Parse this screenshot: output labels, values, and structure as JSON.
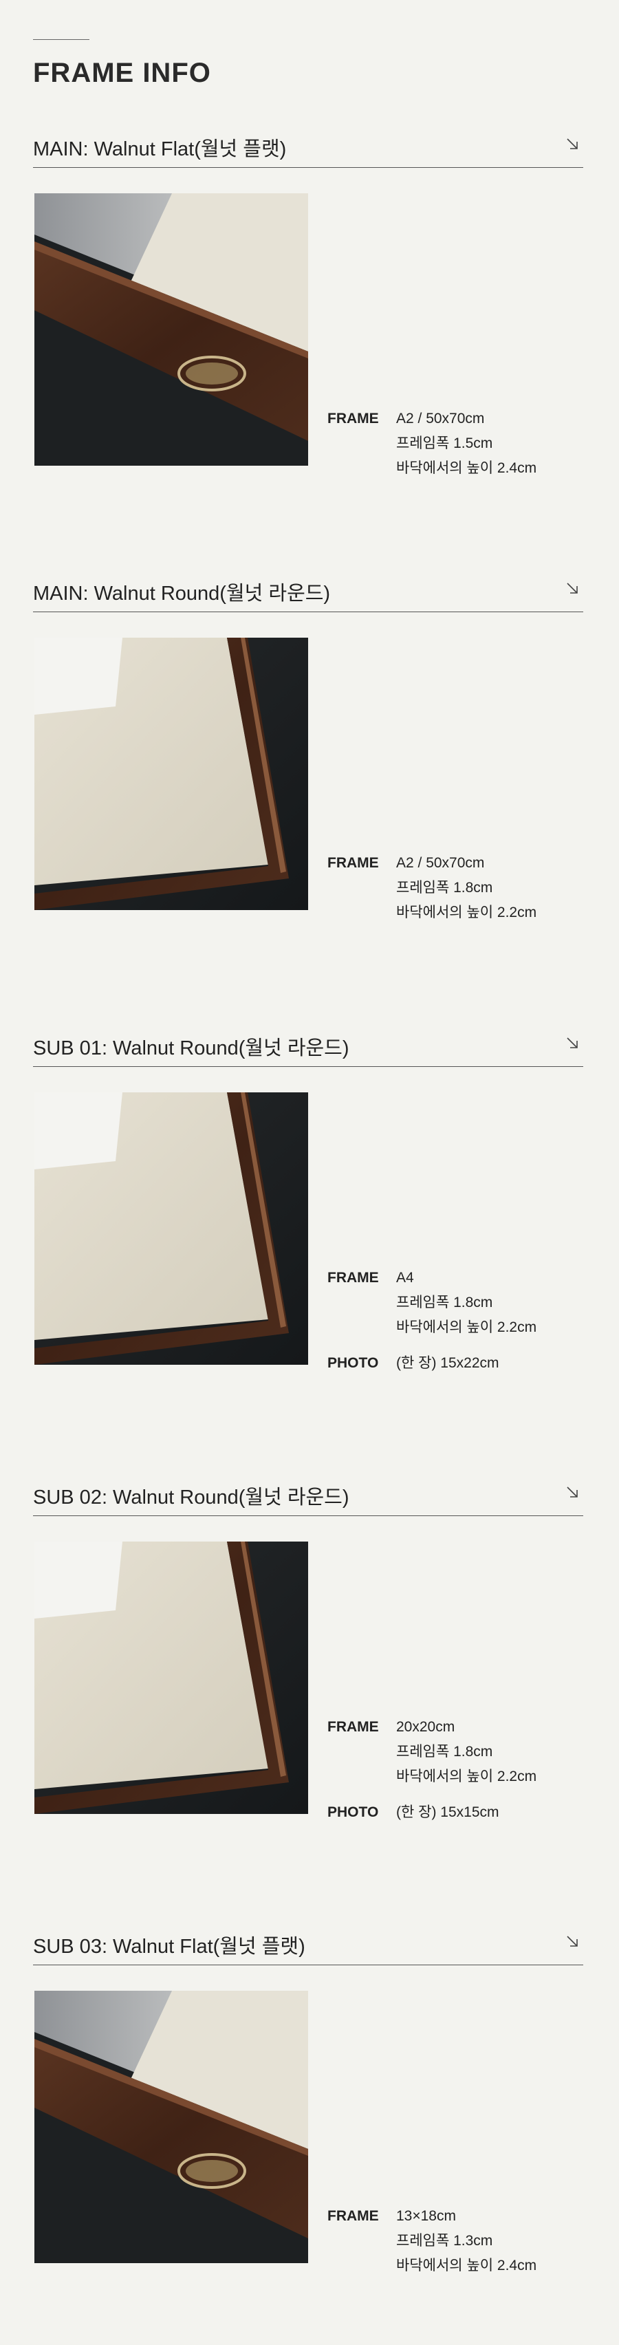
{
  "page": {
    "title": "FRAME INFO"
  },
  "sections": [
    {
      "title": "MAIN: Walnut Flat(월넛 플랫)",
      "image": "walnut-flat-frame-photo",
      "frame_label": "FRAME",
      "frame_lines": [
        "A2 / 50x70cm",
        "프레임폭 1.5cm",
        "바닥에서의 높이 2.4cm"
      ]
    },
    {
      "title": "MAIN: Walnut Round(월넛 라운드)",
      "image": "walnut-round-frame-photo",
      "frame_label": "FRAME",
      "frame_lines": [
        "A2 / 50x70cm",
        "프레임폭 1.8cm",
        "바닥에서의 높이 2.2cm"
      ]
    },
    {
      "title": "SUB 01: Walnut Round(월넛 라운드)",
      "image": "walnut-round-frame-photo",
      "frame_label": "FRAME",
      "frame_lines": [
        "A4",
        "프레임폭 1.8cm",
        "바닥에서의 높이 2.2cm"
      ],
      "photo_label": "PHOTO",
      "photo_value": "(한 장) 15x22cm"
    },
    {
      "title": "SUB 02: Walnut Round(월넛 라운드)",
      "image": "walnut-round-frame-photo",
      "frame_label": "FRAME",
      "frame_lines": [
        "20x20cm",
        "프레임폭 1.8cm",
        "바닥에서의 높이 2.2cm"
      ],
      "photo_label": "PHOTO",
      "photo_value": "(한 장) 15x15cm"
    },
    {
      "title": "SUB 03: Walnut Flat(월넛 플랫)",
      "image": "walnut-flat-frame-photo",
      "frame_label": "FRAME",
      "frame_lines": [
        "13×18cm",
        "프레임폭 1.3cm",
        "바닥에서의 높이 2.4cm"
      ]
    }
  ],
  "icons": {
    "section_arrow": "arrow-down-right-icon"
  },
  "colors": {
    "background": "#f3f3ef",
    "walnut": "#4a2b1c",
    "mat": "#e4dfd0"
  }
}
